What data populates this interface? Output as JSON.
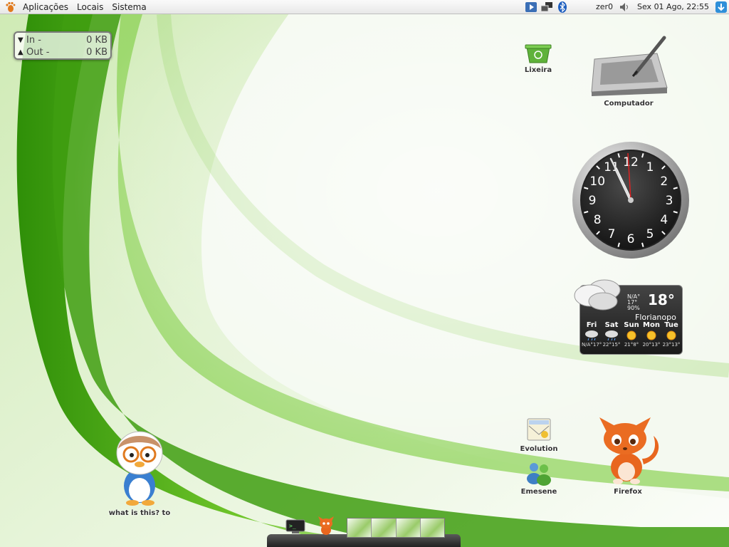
{
  "top_panel": {
    "menus": [
      {
        "label": "Aplicações"
      },
      {
        "label": "Locais"
      },
      {
        "label": "Sistema"
      }
    ],
    "user": "zer0",
    "datetime": "Sex 01 Ago, 22:55"
  },
  "netmon": {
    "in_label": "In -",
    "in_value": "0 KB",
    "out_label": "Out -",
    "out_value": "0 KB"
  },
  "desktop_icons": {
    "trash": "Lixeira",
    "computer": "Computador",
    "evolution": "Evolution",
    "emesene": "Emesene",
    "firefox": "Firefox",
    "file": "what is this? to"
  },
  "clock": {
    "numbers": [
      "12",
      "1",
      "2",
      "3",
      "4",
      "5",
      "6",
      "7",
      "8",
      "9",
      "10",
      "11"
    ]
  },
  "weather": {
    "current_temp": "18°",
    "current_lines": [
      "N/A°",
      "17°",
      "90%"
    ],
    "city": "Florianopo",
    "days": [
      {
        "name": "Fri",
        "range": "N/A°17°",
        "icon": "rain-icon"
      },
      {
        "name": "Sat",
        "range": "22°15°",
        "icon": "rain-icon"
      },
      {
        "name": "Sun",
        "range": "21°8°",
        "icon": "sun-icon"
      },
      {
        "name": "Mon",
        "range": "20°13°",
        "icon": "sun-icon"
      },
      {
        "name": "Tue",
        "range": "23°13°",
        "icon": "sun-icon"
      }
    ]
  },
  "colors": {
    "wallpaper_green": "#4aa814",
    "panel_bg": "#f0f0f0",
    "update_blue": "#2f8fd9"
  }
}
